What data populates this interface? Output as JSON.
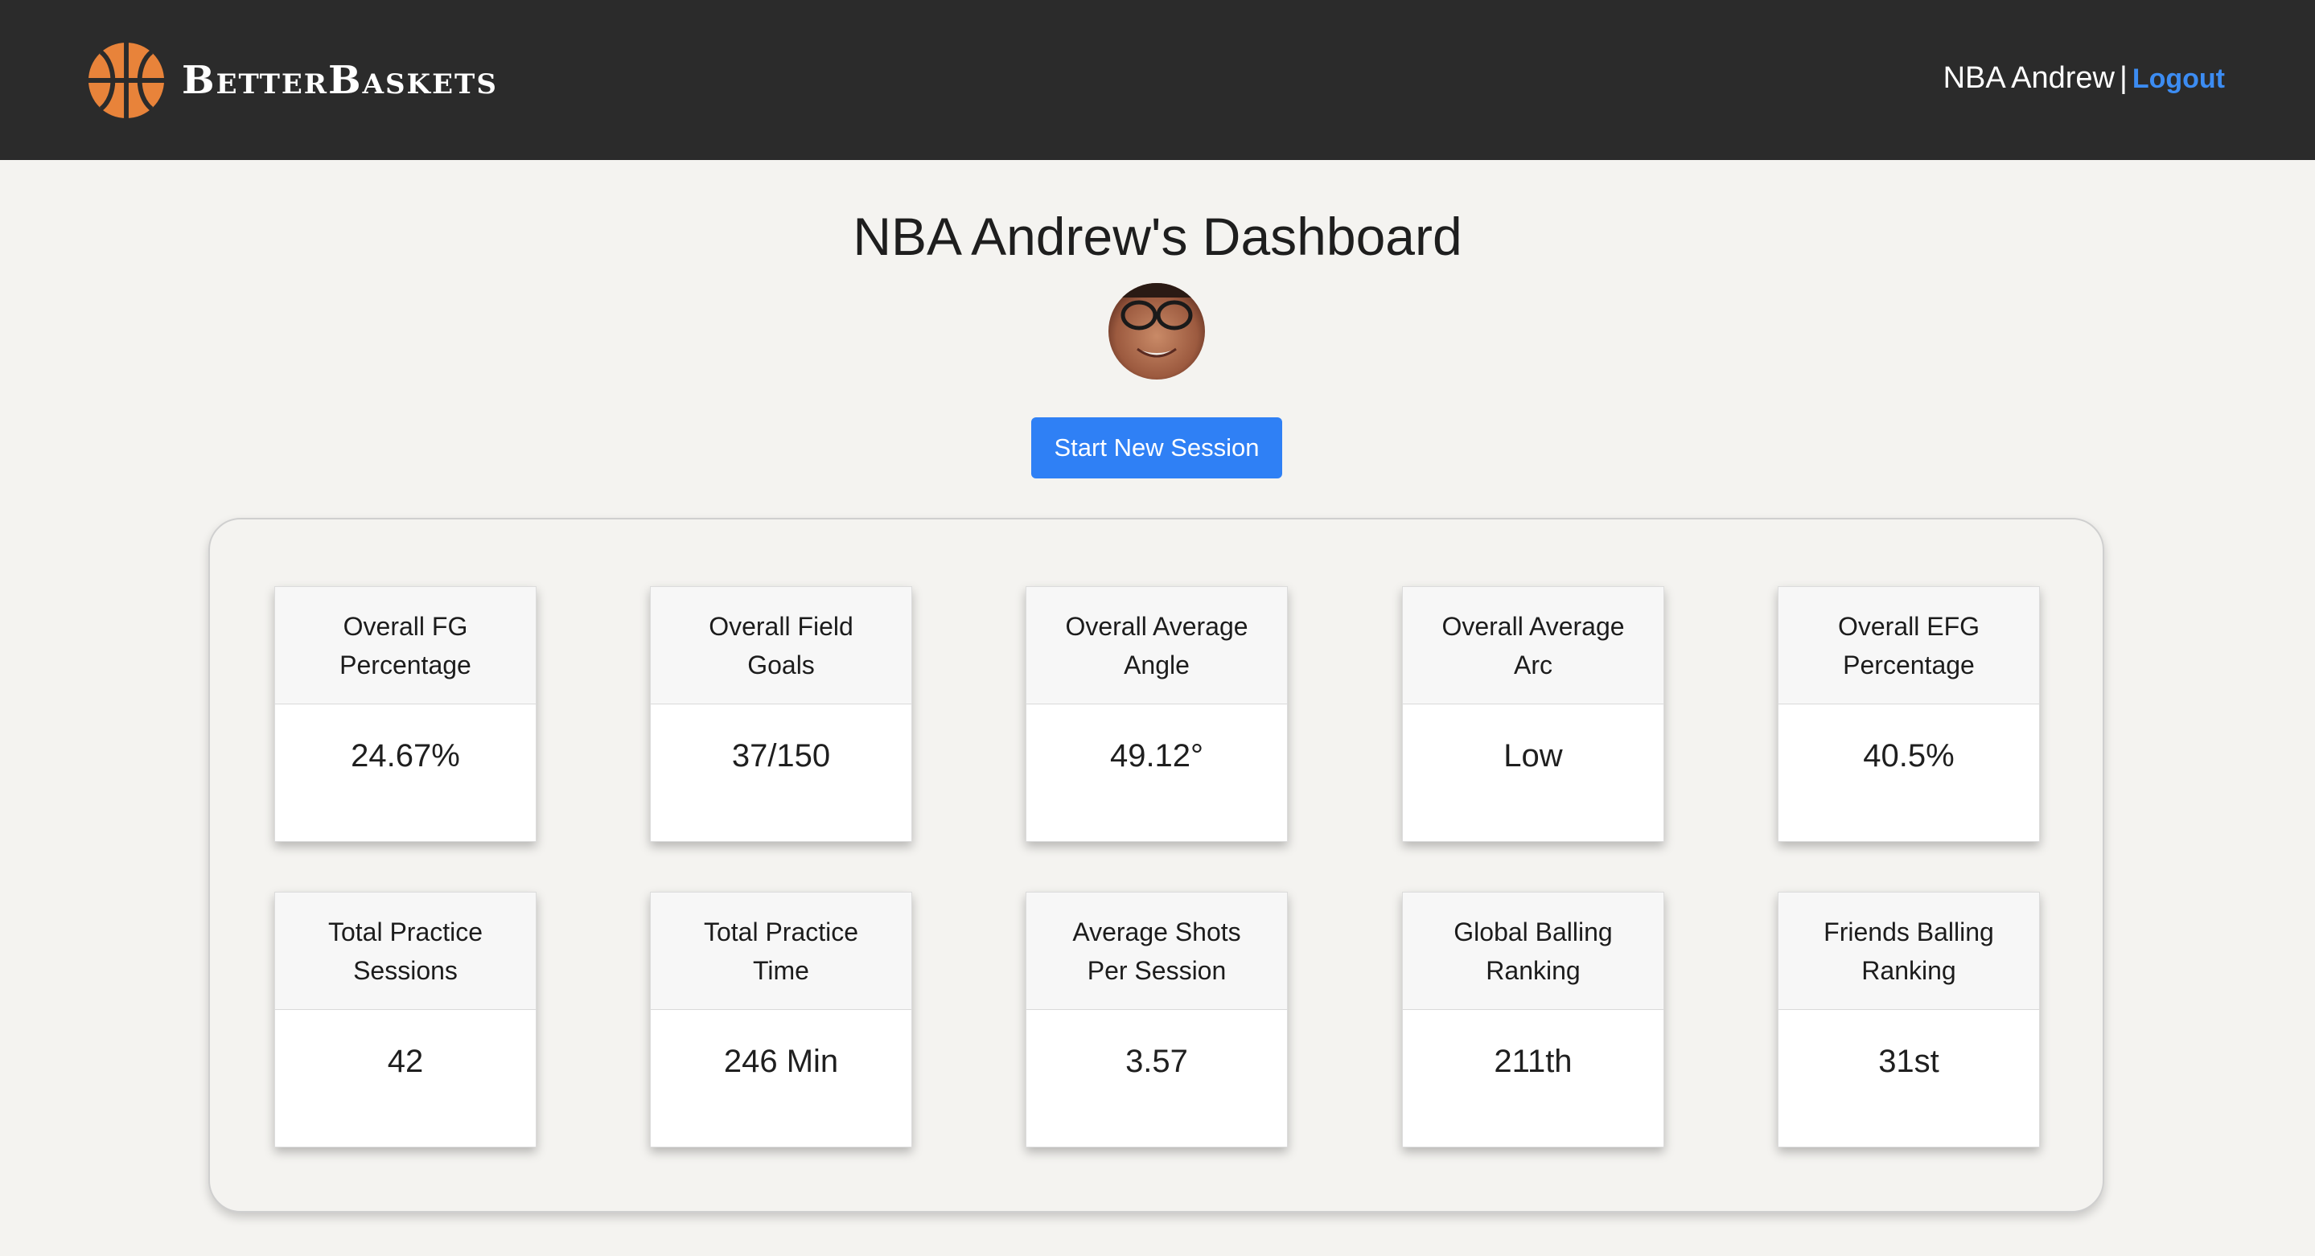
{
  "header": {
    "brand": "BetterBaskets",
    "logo_icon": "basketball-icon",
    "username": "NBA Andrew",
    "separator": "|",
    "logout_label": "Logout"
  },
  "page": {
    "title": "NBA Andrew's Dashboard",
    "start_button_label": "Start New Session"
  },
  "stats": [
    {
      "label": "Overall FG Percentage",
      "value": "24.67%"
    },
    {
      "label": "Overall Field Goals",
      "value": "37/150"
    },
    {
      "label": "Overall Average Angle",
      "value": "49.12°"
    },
    {
      "label": "Overall Average Arc",
      "value": "Low"
    },
    {
      "label": "Overall EFG Percentage",
      "value": "40.5%"
    },
    {
      "label": "Total Practice Sessions",
      "value": "42"
    },
    {
      "label": "Total Practice Time",
      "value": "246 Min"
    },
    {
      "label": "Average Shots Per Session",
      "value": "3.57"
    },
    {
      "label": "Global Balling Ranking",
      "value": "211th"
    },
    {
      "label": "Friends Balling Ranking",
      "value": "31st"
    }
  ],
  "colors": {
    "navbar": "#2b2b2b",
    "accent": "#2f80f5",
    "link": "#3c8cf2",
    "ball": "#e8833a",
    "background": "#f4f3f0"
  }
}
